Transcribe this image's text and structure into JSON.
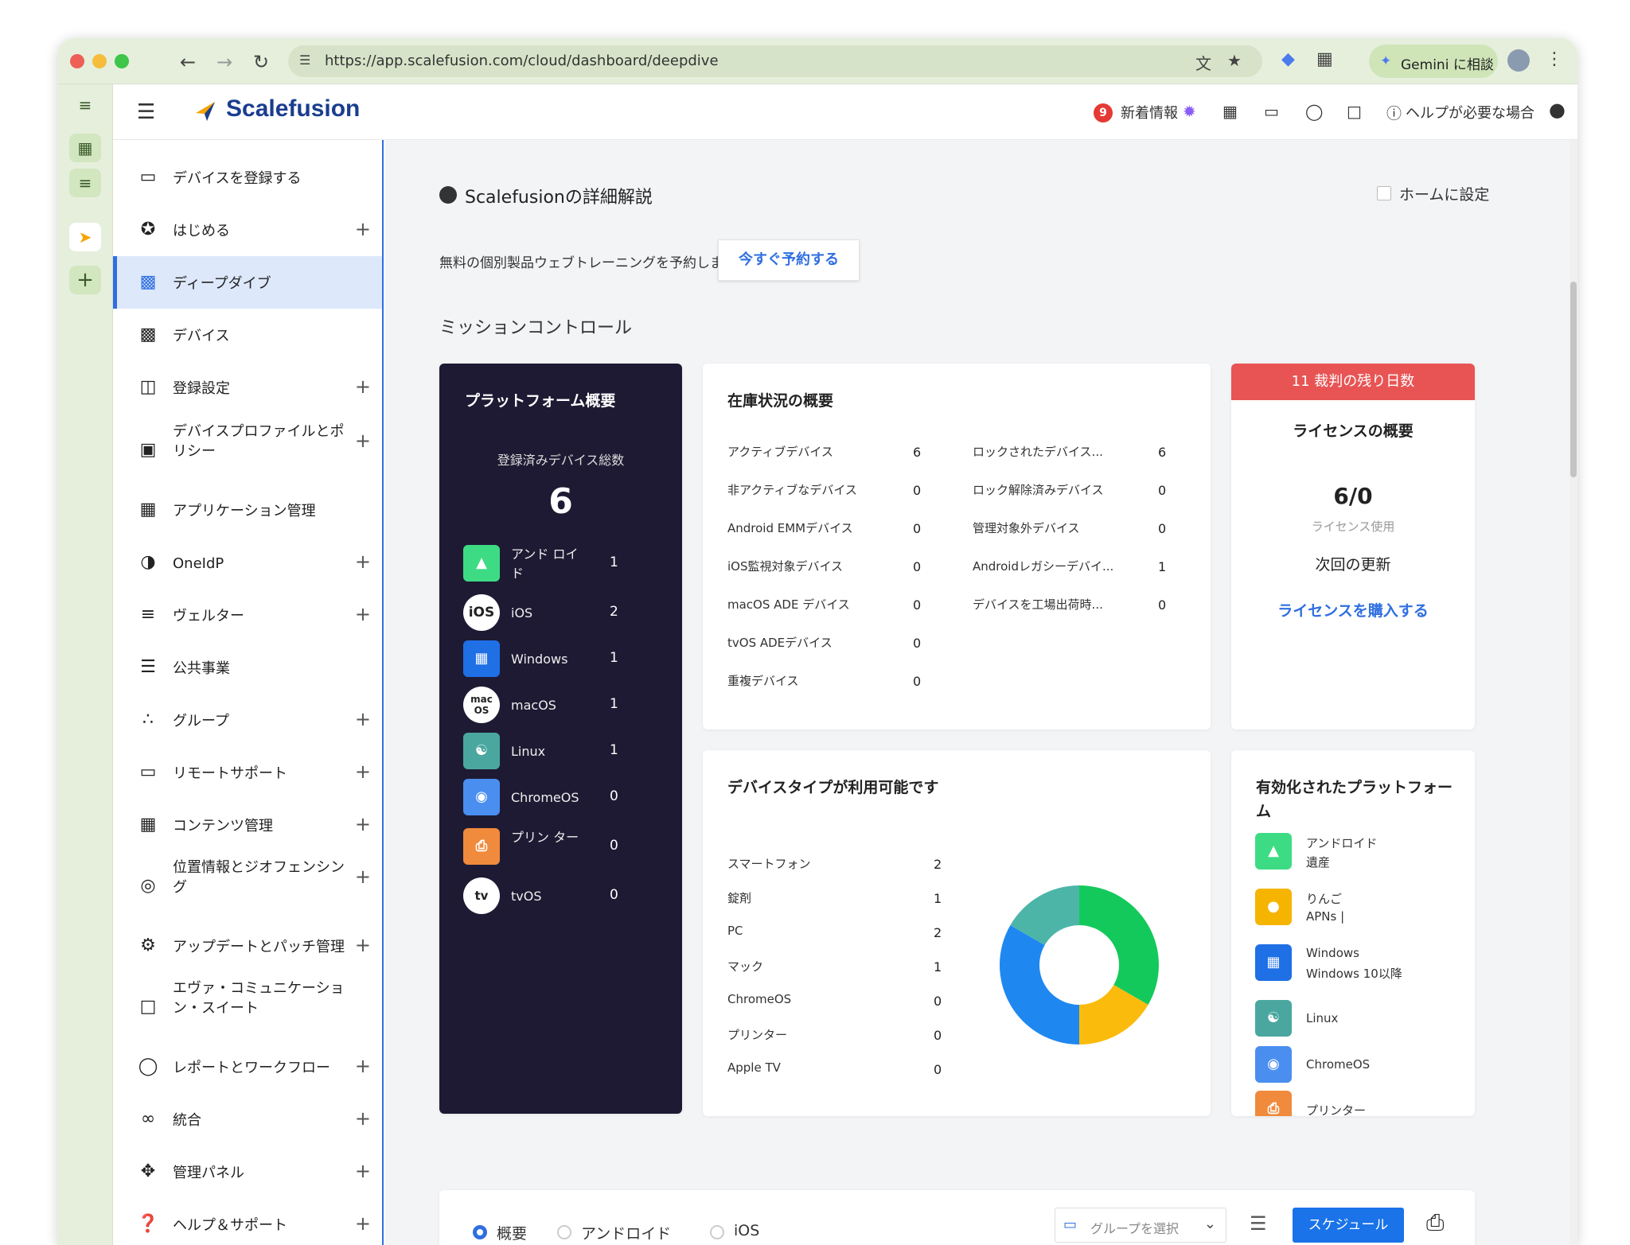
{
  "browser": {
    "url": "https://app.scalefusion.com/cloud/dashboard/deepdive",
    "gemini_label": "Gemini に相談"
  },
  "app": {
    "logo_text": "Scalefusion",
    "header": {
      "notification_count": "9",
      "whats_new": "新着情報",
      "help": "ヘルプが必要な場合"
    }
  },
  "sidebar": {
    "items": [
      {
        "label": "デバイスを登録する",
        "icon": "device-register-icon",
        "plus": false
      },
      {
        "label": "はじめる",
        "icon": "star-icon",
        "plus": true
      },
      {
        "label": "ディープダイブ",
        "icon": "bar-chart-icon",
        "plus": false,
        "active": true
      },
      {
        "label": "デバイス",
        "icon": "device-icon",
        "plus": false
      },
      {
        "label": "登録設定",
        "icon": "enroll-settings-icon",
        "plus": true
      },
      {
        "label": "デバイスプロファイルとポリシー",
        "icon": "clipboard-icon",
        "plus": true
      },
      {
        "label": "アプリケーション管理",
        "icon": "apps-grid-icon",
        "plus": false
      },
      {
        "label": "OneIdP",
        "icon": "oneidp-icon",
        "plus": true
      },
      {
        "label": "ヴェルター",
        "icon": "layers-icon",
        "plus": true
      },
      {
        "label": "公共事業",
        "icon": "utilities-icon",
        "plus": false
      },
      {
        "label": "グループ",
        "icon": "groups-icon",
        "plus": true
      },
      {
        "label": "リモートサポート",
        "icon": "cast-icon",
        "plus": true
      },
      {
        "label": "コンテンツ管理",
        "icon": "photo-library-icon",
        "plus": true
      },
      {
        "label": "位置情報とジオフェンシング",
        "icon": "location-icon",
        "plus": true
      },
      {
        "label": "アップデートとパッチ管理",
        "icon": "gear-icon",
        "plus": true
      },
      {
        "label": "エヴァ・コミュニケーション・スイート",
        "icon": "chat-icon",
        "plus": false
      },
      {
        "label": "レポートとワークフロー",
        "icon": "reports-icon",
        "plus": true
      },
      {
        "label": "統合",
        "icon": "link-icon",
        "plus": true
      },
      {
        "label": "管理パネル",
        "icon": "admin-panel-icon",
        "plus": true
      },
      {
        "label": "ヘルプ＆サポート",
        "icon": "help-icon",
        "plus": true
      }
    ]
  },
  "main": {
    "page_title": "Scalefusionの詳細解説",
    "home_set_label": "ホームに設定",
    "training_text": "無料の個別製品ウェブトレーニングを予約しましょう。",
    "reserve_button": "今すぐ予約する",
    "section_title": "ミッションコントロール",
    "platform_summary": {
      "title": "プラットフォーム概要",
      "total_label": "登録済みデバイス総数",
      "total": "6",
      "rows": [
        {
          "name": "アンド ロイド",
          "count": "1",
          "icon": "android-icon"
        },
        {
          "name": "iOS",
          "count": "2",
          "icon": "ios-icon"
        },
        {
          "name": "Windows",
          "count": "1",
          "icon": "windows-icon"
        },
        {
          "name": "macOS",
          "count": "1",
          "icon": "macos-icon"
        },
        {
          "name": "Linux",
          "count": "1",
          "icon": "linux-icon"
        },
        {
          "name": "ChromeOS",
          "count": "0",
          "icon": "chrome-icon"
        },
        {
          "name": "プリン ター",
          "count": "0",
          "icon": "printer-icon"
        },
        {
          "name": "tvOS",
          "count": "0",
          "icon": "appletv-icon"
        }
      ]
    },
    "inventory": {
      "title": "在庫状況の概要",
      "left": [
        {
          "label": "アクティブデバイス",
          "value": "6"
        },
        {
          "label": "非アクティブなデバイス",
          "value": "0"
        },
        {
          "label": "Android EMMデバイス",
          "value": "0"
        },
        {
          "label": "iOS監視対象デバイス",
          "value": "0"
        },
        {
          "label": "macOS ADE デバイス",
          "value": "0"
        },
        {
          "label": "tvOS ADEデバイス",
          "value": "0"
        },
        {
          "label": "重複デバイス",
          "value": "0"
        }
      ],
      "right": [
        {
          "label": "ロックされたデバイス...",
          "value": "6"
        },
        {
          "label": "ロック解除済みデバイス",
          "value": "0"
        },
        {
          "label": "管理対象外デバイス",
          "value": "0"
        },
        {
          "label": "Androidレガシーデバイ...",
          "value": "1"
        },
        {
          "label": "デバイスを工場出荷時...",
          "value": "0"
        }
      ]
    },
    "license": {
      "banner": "11 裁判の残り日数",
      "title": "ライセンスの概要",
      "usage": "6/0",
      "usage_label": "ライセンス使用",
      "renewal": "次回の更新",
      "buy": "ライセンスを購入する"
    },
    "device_types": {
      "title": "デバイスタイプが利用可能です",
      "rows": [
        {
          "label": "スマートフォン",
          "value": "2"
        },
        {
          "label": "錠剤",
          "value": "1"
        },
        {
          "label": "PC",
          "value": "2"
        },
        {
          "label": "マック",
          "value": "1"
        },
        {
          "label": "ChromeOS",
          "value": "0"
        },
        {
          "label": "プリンター",
          "value": "0"
        },
        {
          "label": "Apple TV",
          "value": "0"
        }
      ]
    },
    "enabled_platforms": {
      "title": "有効化されたプラットフォーム",
      "rows": [
        {
          "line1": "アンドロイド",
          "line2": "遺産",
          "icon": "android-icon",
          "color": "#3ddc84"
        },
        {
          "line1": "りんご",
          "line2": "APNs |",
          "icon": "apple-icon",
          "color": "#f5b400"
        },
        {
          "line1": "Windows",
          "line2": "Windows 10以降",
          "icon": "windows-icon",
          "color": "#1f6fe5"
        },
        {
          "line1": "Linux",
          "line2": "",
          "icon": "linux-icon",
          "color": "#4aa7a0"
        },
        {
          "line1": "ChromeOS",
          "line2": "",
          "icon": "chrome-icon",
          "color": "#4a8ef0"
        },
        {
          "line1": "プリンター",
          "line2": "",
          "icon": "printer-icon",
          "color": "#f08a3c"
        }
      ]
    },
    "bottom": {
      "tabs": [
        "概要",
        "アンドロイド",
        "iOS"
      ],
      "group_placeholder": "グループを選択",
      "schedule": "スケジュール"
    }
  },
  "chart_data": {
    "type": "pie",
    "categories": [
      "スマートフォン",
      "錠剤",
      "PC",
      "マック",
      "ChromeOS",
      "プリンター",
      "Apple TV"
    ],
    "values": [
      2,
      1,
      2,
      1,
      0,
      0,
      0
    ],
    "colors": [
      "#13c95b",
      "#fbbb0d",
      "#1e88f0",
      "#4db5a8",
      "#8f8f8f",
      "#f08a3c",
      "#555555"
    ],
    "donut": true
  }
}
